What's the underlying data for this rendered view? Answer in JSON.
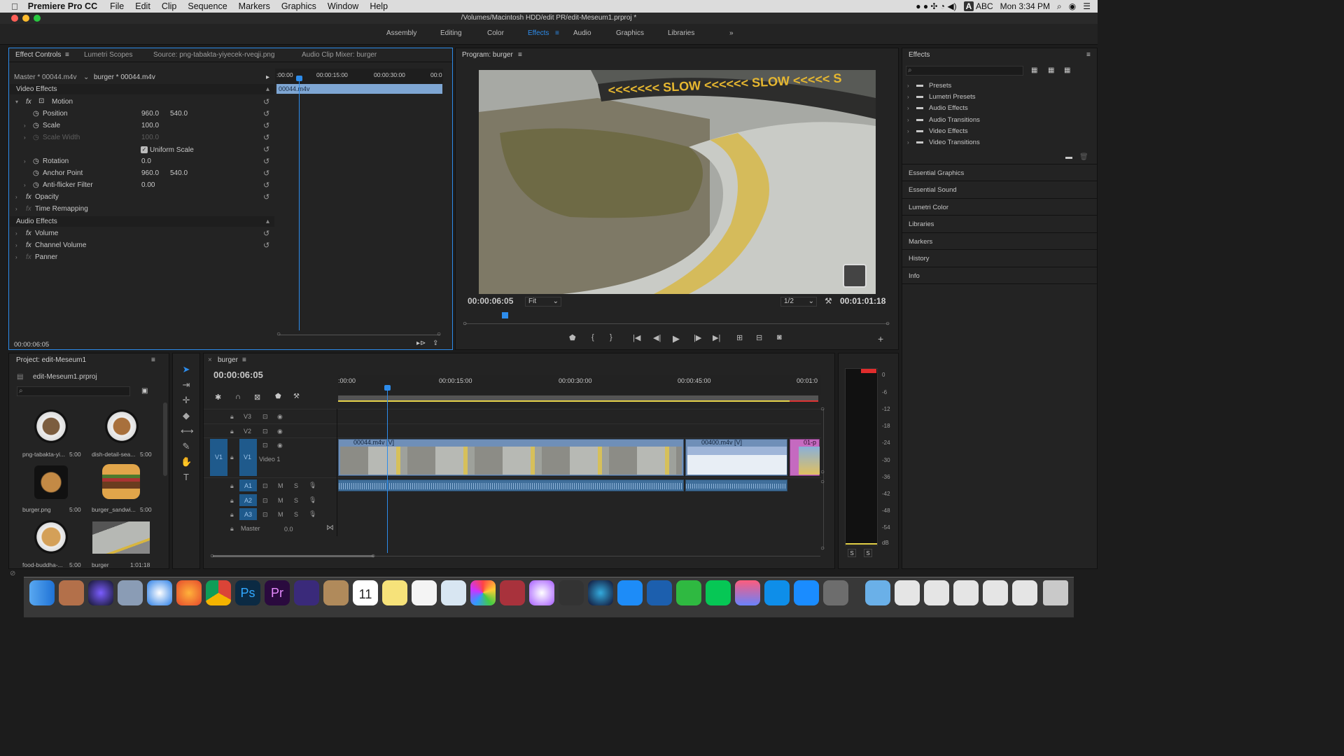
{
  "menubar": {
    "app": "Premiere Pro CC",
    "items": [
      "File",
      "Edit",
      "Clip",
      "Sequence",
      "Markers",
      "Graphics",
      "Window",
      "Help"
    ],
    "input": "ABC",
    "clock": "Mon 3:34 PM"
  },
  "title": "/Volumes/Macintosh HDD/edit PR/edit-Meseum1.prproj *",
  "workspaces": [
    "Assembly",
    "Editing",
    "Color",
    "Effects",
    "Audio",
    "Graphics",
    "Libraries"
  ],
  "effect_controls": {
    "tabs": [
      "Effect Controls",
      "Lumetri Scopes",
      "Source: png-tabakta-yiyecek-rveqji.png",
      "Audio Clip Mixer: burger"
    ],
    "master": "Master * 00044.m4v",
    "sequence_clip": "burger * 00044.m4v",
    "ruler": [
      ":00:00",
      "00:00:15:00",
      "00:00:30:00",
      "00:0"
    ],
    "clip_name": "00044.m4v",
    "video_effects": "Video Effects",
    "motion": "Motion",
    "position": {
      "label": "Position",
      "x": "960.0",
      "y": "540.0"
    },
    "scale": {
      "label": "Scale",
      "value": "100.0"
    },
    "scale_width": {
      "label": "Scale Width",
      "value": "100.0"
    },
    "uniform_scale": "Uniform Scale",
    "rotation": {
      "label": "Rotation",
      "value": "0.0"
    },
    "anchor": {
      "label": "Anchor Point",
      "x": "960.0",
      "y": "540.0"
    },
    "antiflicker": {
      "label": "Anti-flicker Filter",
      "value": "0.00"
    },
    "opacity": "Opacity",
    "time_remap": "Time Remapping",
    "audio_effects": "Audio Effects",
    "volume": "Volume",
    "channel_volume": "Channel Volume",
    "panner": "Panner",
    "timecode": "00:00:06:05"
  },
  "program": {
    "title": "Program: burger",
    "timecode": "00:00:06:05",
    "fit": "Fit",
    "res": "1/2",
    "duration": "00:01:01:18",
    "overlay_text": "<<<<<<< SLOW <<<<<< SLOW <<<<< S"
  },
  "effects_panel": {
    "title": "Effects",
    "folders": [
      "Presets",
      "Lumetri Presets",
      "Audio Effects",
      "Audio Transitions",
      "Video Effects",
      "Video Transitions"
    ],
    "sections": [
      "Essential Graphics",
      "Essential Sound",
      "Lumetri Color",
      "Libraries",
      "Markers",
      "History",
      "Info"
    ]
  },
  "project": {
    "title": "Project: edit-Meseum1",
    "file": "edit-Meseum1.prproj",
    "items": [
      {
        "name": "png-tabakta-yi...",
        "dur": "5:00",
        "color": "#6b5e4e"
      },
      {
        "name": "dish-detail-sea...",
        "dur": "5:00",
        "color": "#8a6e4a"
      },
      {
        "name": "burger.png",
        "dur": "5:00",
        "color": "#a86a3a"
      },
      {
        "name": "burger_sandwi...",
        "dur": "5:00",
        "color": "#b9783a"
      },
      {
        "name": "food-buddha-...",
        "dur": "5:00",
        "color": "#c69a5a"
      },
      {
        "name": "burger",
        "dur": "1:01:18",
        "color": "#7f8a86"
      }
    ]
  },
  "timeline": {
    "seq": "burger",
    "timecode": "00:00:06:05",
    "ruler": [
      ":00:00",
      "00:00:15:00",
      "00:00:30:00",
      "00:00:45:00",
      "00:01:0"
    ],
    "tracks_v": [
      "V3",
      "V2",
      "V1"
    ],
    "track_v1_label": "Video 1",
    "source_v": "V1",
    "tracks_a": [
      "A1",
      "A2",
      "A3"
    ],
    "master": "Master",
    "master_val": "0.0",
    "clips": [
      "00044.m4v [V]",
      "00400.m4v [V]",
      "01-p"
    ]
  },
  "meter": {
    "scale": [
      "0",
      "-6",
      "-12",
      "-18",
      "-24",
      "-30",
      "-36",
      "-42",
      "-48",
      "-54",
      "dB"
    ],
    "solo": [
      "S",
      "S"
    ]
  },
  "colors": {
    "accent": "#2d8ceb",
    "panel": "#232323",
    "clip_v": "#6f8fb8",
    "clip_a": "#3f6e9a",
    "audio_wave": "#8fb4d9",
    "marker_bar": "#e6d34a"
  }
}
